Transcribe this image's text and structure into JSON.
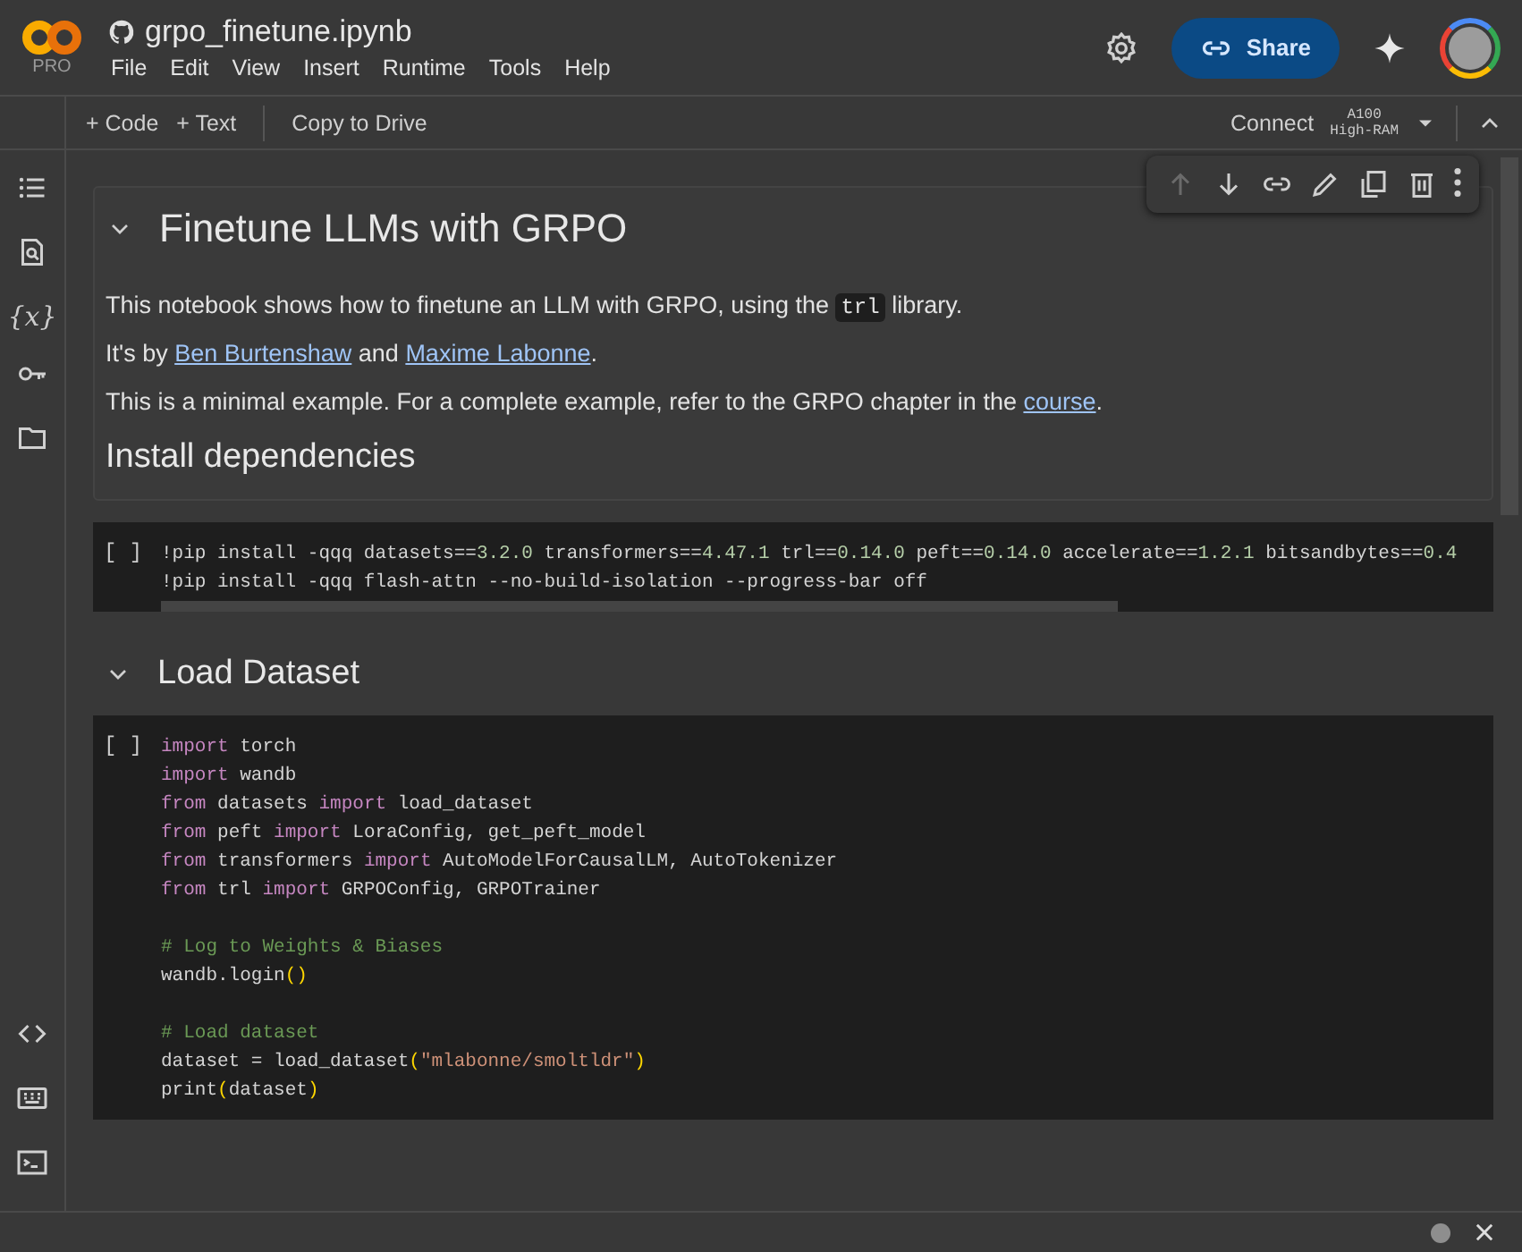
{
  "header": {
    "logo_badge": "PRO",
    "title": "grpo_finetune.ipynb",
    "menu": [
      "File",
      "Edit",
      "View",
      "Insert",
      "Runtime",
      "Tools",
      "Help"
    ],
    "share_button": "Share"
  },
  "toolbar": {
    "buttons": [
      "+ Code",
      "+ Text"
    ],
    "copy_button": "Copy to Drive",
    "connect_button": "Connect",
    "runtime": [
      "A100",
      "High-RAM"
    ]
  },
  "sidebar": {
    "variables_glyph": "{x}"
  },
  "cell_toolbar": {
    "move_up_disabled": true
  },
  "cells": [
    {
      "kind": "text",
      "heading": "Finetune LLMs with GRPO",
      "expanded": true,
      "paragraphs": [
        [
          {
            "kind": "text",
            "text": "This notebook shows how to finetune an LLM with GRPO, using the "
          },
          {
            "kind": "code",
            "text": "trl"
          },
          {
            "kind": "text",
            "text": " library."
          }
        ],
        [
          {
            "kind": "text",
            "text": "It's by "
          },
          {
            "kind": "link",
            "text": "Ben Burtenshaw"
          },
          {
            "kind": "text",
            "text": " and "
          },
          {
            "kind": "link",
            "text": "Maxime Labonne"
          },
          {
            "kind": "text",
            "text": "."
          }
        ],
        [
          {
            "kind": "text",
            "text": "This is a minimal example. For a complete example, refer to the GRPO chapter in the "
          },
          {
            "kind": "link",
            "text": "course"
          },
          {
            "kind": "text",
            "text": "."
          }
        ]
      ],
      "subheading": "Install dependencies"
    },
    {
      "kind": "code",
      "prompt": "[ ]",
      "scrollbar": true,
      "blocks": [
        [
          [
            {
              "kind": "plain",
              "text": "!pip install -qqq datasets=="
            },
            {
              "kind": "number",
              "text": "3.2.0"
            },
            {
              "kind": "plain",
              "text": " transformers=="
            },
            {
              "kind": "number",
              "text": "4.47.1"
            },
            {
              "kind": "plain",
              "text": " trl=="
            },
            {
              "kind": "number",
              "text": "0.14.0"
            },
            {
              "kind": "plain",
              "text": " peft=="
            },
            {
              "kind": "number",
              "text": "0.14.0"
            },
            {
              "kind": "plain",
              "text": " accelerate=="
            },
            {
              "kind": "number",
              "text": "1.2.1"
            },
            {
              "kind": "plain",
              "text": " bitsandbytes=="
            },
            {
              "kind": "number",
              "text": "0.4"
            }
          ],
          [
            {
              "kind": "plain",
              "text": "!pip install -qqq flash-attn --no-build-isolation --progress-bar off"
            }
          ]
        ]
      ]
    },
    {
      "kind": "heading",
      "heading": "Load Dataset",
      "expanded": true
    },
    {
      "kind": "code",
      "prompt": "[ ]",
      "scrollbar": false,
      "blocks": [
        [
          [
            {
              "kind": "keyword",
              "text": "import"
            },
            {
              "kind": "plain",
              "text": " torch"
            }
          ],
          [
            {
              "kind": "keyword",
              "text": "import"
            },
            {
              "kind": "plain",
              "text": " wandb"
            }
          ],
          [
            {
              "kind": "keyword",
              "text": "from"
            },
            {
              "kind": "plain",
              "text": " datasets "
            },
            {
              "kind": "keyword",
              "text": "import"
            },
            {
              "kind": "plain",
              "text": " load_dataset"
            }
          ],
          [
            {
              "kind": "keyword",
              "text": "from"
            },
            {
              "kind": "plain",
              "text": " peft "
            },
            {
              "kind": "keyword",
              "text": "import"
            },
            {
              "kind": "plain",
              "text": " LoraConfig, get_peft_model"
            }
          ],
          [
            {
              "kind": "keyword",
              "text": "from"
            },
            {
              "kind": "plain",
              "text": " transformers "
            },
            {
              "kind": "keyword",
              "text": "import"
            },
            {
              "kind": "plain",
              "text": " AutoModelForCausalLM, AutoTokenizer"
            }
          ],
          [
            {
              "kind": "keyword",
              "text": "from"
            },
            {
              "kind": "plain",
              "text": " trl "
            },
            {
              "kind": "keyword",
              "text": "import"
            },
            {
              "kind": "plain",
              "text": " GRPOConfig, GRPOTrainer"
            }
          ]
        ],
        [
          [
            {
              "kind": "comment",
              "text": "# Log to Weights & Biases"
            }
          ],
          [
            {
              "kind": "plain",
              "text": "wandb.login"
            },
            {
              "kind": "paren",
              "text": "()"
            }
          ]
        ],
        [
          [
            {
              "kind": "comment",
              "text": "# Load dataset"
            }
          ],
          [
            {
              "kind": "plain",
              "text": "dataset = load_dataset"
            },
            {
              "kind": "paren",
              "text": "("
            },
            {
              "kind": "string",
              "text": "\"mlabonne/smoltldr\""
            },
            {
              "kind": "paren",
              "text": ")"
            }
          ],
          [
            {
              "kind": "plain",
              "text": "print"
            },
            {
              "kind": "paren",
              "text": "("
            },
            {
              "kind": "plain",
              "text": "dataset"
            },
            {
              "kind": "paren",
              "text": ")"
            }
          ]
        ]
      ]
    }
  ]
}
